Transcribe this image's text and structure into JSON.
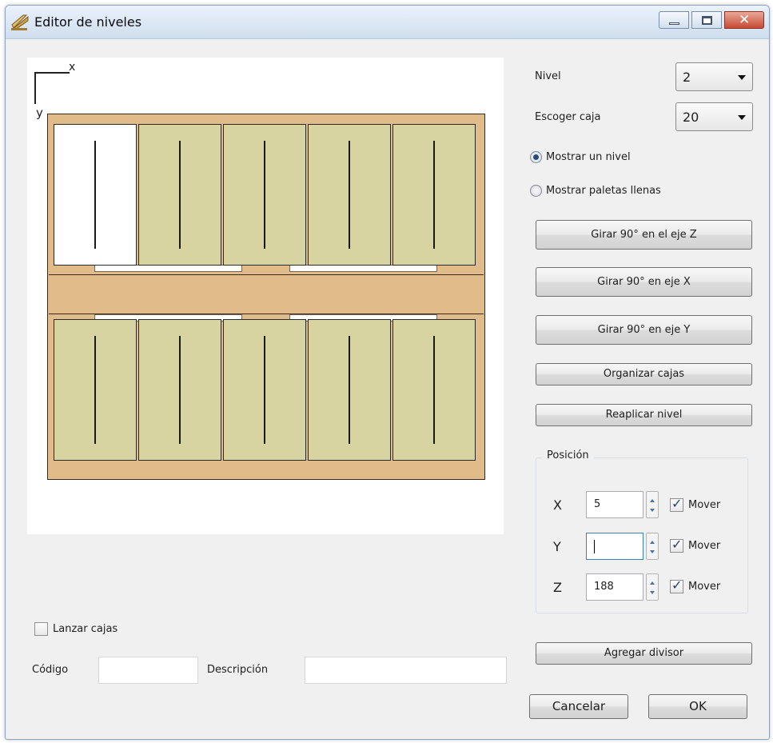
{
  "window": {
    "title": "Editor de niveles",
    "close_glyph": "✕"
  },
  "canvas": {
    "axis_x": "x",
    "axis_y": "y"
  },
  "nivel": {
    "label": "Nivel",
    "value": "2"
  },
  "escoger_caja": {
    "label": "Escoger caja",
    "value": "20"
  },
  "view_mode": {
    "options": [
      "Mostrar un nivel",
      "Mostrar paletas llenas"
    ],
    "selected": "Mostrar un nivel"
  },
  "buttons": {
    "rotate_z": "Girar 90° en el eje Z",
    "rotate_x": "Girar 90° en eje X",
    "rotate_y": "Girar 90° en eje Y",
    "organize": "Organizar cajas",
    "replicate": "Reaplicar nivel",
    "add_divider": "Agregar divisor",
    "cancel": "Cancelar",
    "ok": "OK"
  },
  "position": {
    "title": "Posición",
    "x": {
      "label": "X",
      "value": "5",
      "move_label": "Mover",
      "move_checked": true
    },
    "y": {
      "label": "Y",
      "value": "",
      "move_label": "Mover",
      "move_checked": true
    },
    "z": {
      "label": "Z",
      "value": "188",
      "move_label": "Mover",
      "move_checked": true
    }
  },
  "throw_boxes": {
    "label": "Lanzar cajas",
    "checked": false
  },
  "code": {
    "label": "Código",
    "value": ""
  },
  "description": {
    "label": "Descripción",
    "value": ""
  },
  "colors": {
    "pallet": "#e1bb8a",
    "box": "#d8d4a2",
    "selected_box": "#ffffff"
  },
  "icons": [
    "app-pallet-icon",
    "minimize-icon",
    "maximize-icon",
    "close-icon",
    "spin-up-icon",
    "spin-down-icon",
    "checkmark-icon"
  ]
}
